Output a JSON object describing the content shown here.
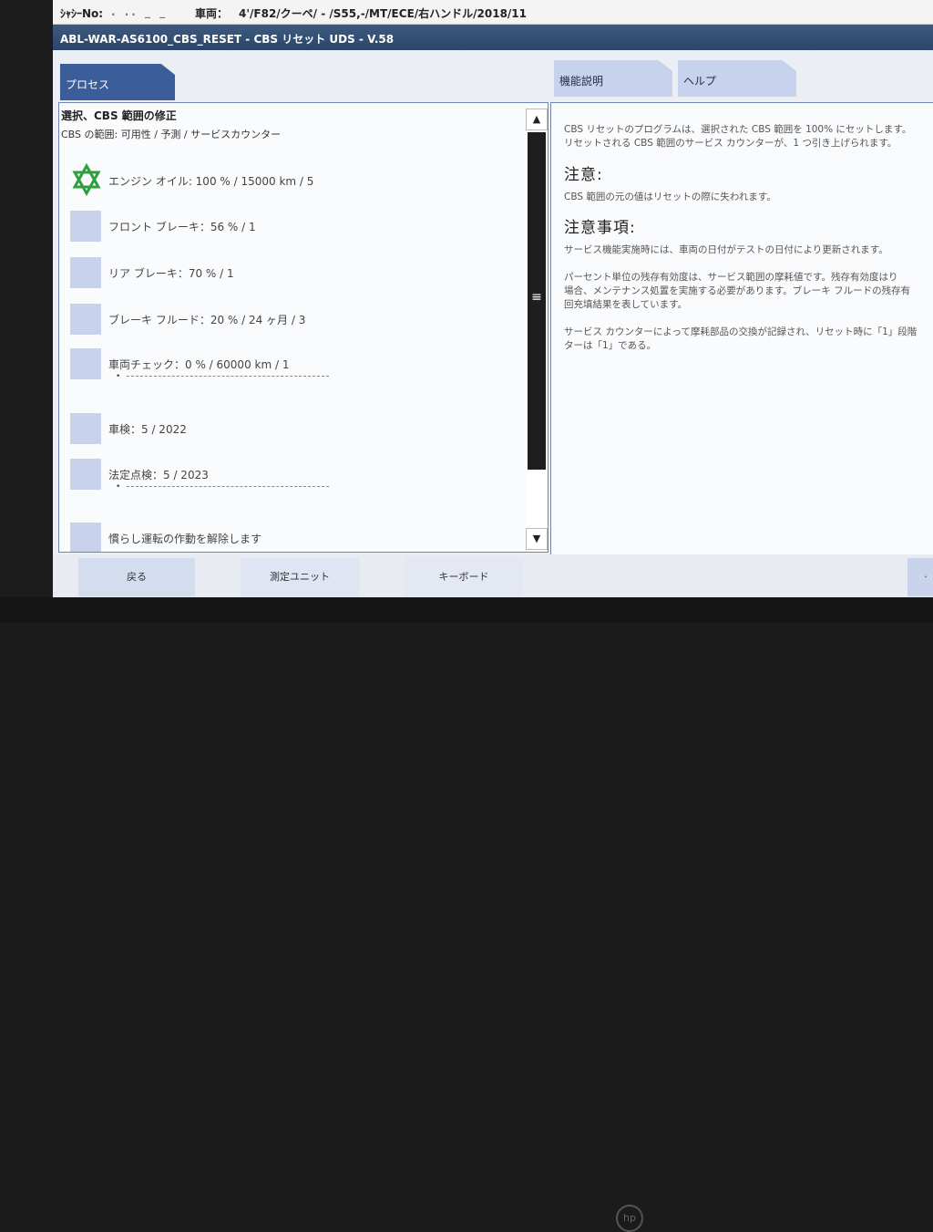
{
  "vehicle_bar": {
    "chassis_label": "ｼｬｼｰNo:",
    "chassis_value": ". .. _ _",
    "vehicle_label": "車両：",
    "vehicle_value": "4'/F82/クーペ/ - /S55,-/MT/ECE/右ハンドル/2018/11"
  },
  "window_title": "ABL-WAR-AS6100_CBS_RESET - CBS リセット UDS - V.58",
  "tabs": {
    "process": "プロセス",
    "function_description": "機能説明",
    "help": "ヘルプ"
  },
  "left_panel": {
    "title": "選択、CBS 範囲の修正",
    "subtitle": "CBS の範囲: 可用性 / 予測 / サービスカウンター",
    "items": [
      {
        "label": "エンジン オイル: 100 % / 15000 km / 5",
        "icon": "star-icon",
        "selected": true
      },
      {
        "label": "フロント ブレーキ：56 % / 1",
        "icon": "box"
      },
      {
        "label": "リア ブレーキ：70 % / 1",
        "icon": "box"
      },
      {
        "label": "ブレーキ フルード：20 % / 24 ヶ月 / 3",
        "icon": "box"
      },
      {
        "label": "車両チェック：0 % / 60000 km / 1",
        "icon": "box",
        "bullet": "•"
      },
      {
        "label": "車検：5 / 2022",
        "icon": "box"
      },
      {
        "label": "法定点検：5 / 2023",
        "icon": "box",
        "bullet": "•"
      },
      {
        "label": "慣らし運転の作動を解除します",
        "icon": "box"
      }
    ],
    "scroll_up_glyph": "▲",
    "scroll_down_glyph": "▼",
    "scroll_grip_glyph": "≡"
  },
  "right_panel": {
    "intro_line1": "CBS リセットのプログラムは、選択された CBS 範囲を 100% にセットします。",
    "intro_line2": "リセットされる CBS 範囲のサービス カウンターが、1 つ引き上げられます。",
    "caution_heading": "注意:",
    "caution_text": "CBS 範囲の元の値はリセットの際に失われます。",
    "notes_heading": "注意事項:",
    "note1": "サービス機能実施時には、車両の日付がテストの日付により更新されます。",
    "note2_line1": "パーセント単位の残存有効度は、サービス範囲の摩耗値です。残存有効度はり",
    "note2_line2": "場合、メンテナンス処置を実施する必要があります。ブレーキ フルードの残存有",
    "note2_line3": "回充填結果を表しています。",
    "note3_line1": "サービス カウンターによって摩耗部品の交換が記録され、リセット時に「1」段階",
    "note3_line2": "ターは「1」である。"
  },
  "footer": {
    "back": "戻る",
    "measure_unit": "測定ユニット",
    "keyboard": "キーボード",
    "right_button": "·"
  },
  "colors": {
    "title_bar": "#2c4568",
    "process_tab": "#3b5d9a",
    "tab": "#c7d2ec",
    "star_green": "#2f9e3c"
  },
  "bezel_logo": "hp"
}
